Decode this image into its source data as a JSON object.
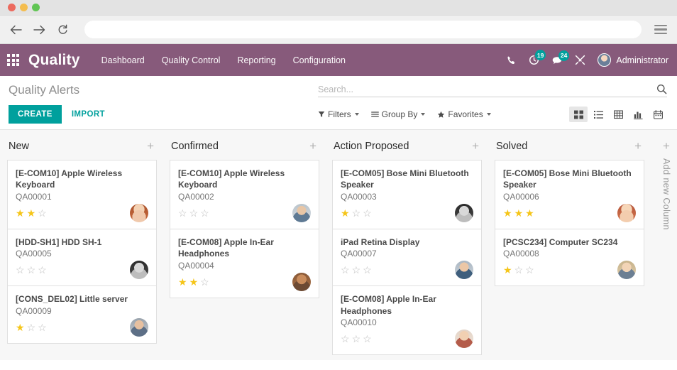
{
  "browser": {
    "back_icon": "back-arrow-icon",
    "forward_icon": "forward-arrow-icon",
    "reload_icon": "reload-icon",
    "url_value": "",
    "menu_icon": "hamburger-menu-icon"
  },
  "navbar": {
    "apps_icon": "apps-grid-icon",
    "brand": "Quality",
    "menu": [
      {
        "label": "Dashboard"
      },
      {
        "label": "Quality Control"
      },
      {
        "label": "Reporting"
      },
      {
        "label": "Configuration"
      }
    ],
    "phone_icon": "phone-icon",
    "activity_icon": "clock-activity-icon",
    "activity_count": "19",
    "messages_icon": "chat-bubble-icon",
    "messages_count": "24",
    "tools_icon": "wrench-tools-icon",
    "user_name": "Administrator",
    "accent_color": "#875a7b",
    "badge_color": "#00a09d"
  },
  "control_panel": {
    "title": "Quality Alerts",
    "create_label": "CREATE",
    "import_label": "IMPORT",
    "create_color": "#00a09d",
    "search": {
      "placeholder": "Search...",
      "value": "",
      "icon": "search-icon"
    },
    "filters": [
      {
        "label": "Filters",
        "icon": "filter-funnel-icon"
      },
      {
        "label": "Group By",
        "icon": "group-lines-icon"
      },
      {
        "label": "Favorites",
        "icon": "star-icon"
      }
    ],
    "views": [
      {
        "name": "kanban",
        "icon": "kanban-view-icon",
        "active": true
      },
      {
        "name": "list",
        "icon": "list-view-icon",
        "active": false
      },
      {
        "name": "pivot",
        "icon": "pivot-table-view-icon",
        "active": false
      },
      {
        "name": "graph",
        "icon": "bar-chart-view-icon",
        "active": false
      },
      {
        "name": "calendar",
        "icon": "calendar-view-icon",
        "active": false
      }
    ]
  },
  "kanban": {
    "add_column_label": "Add new Column",
    "columns": [
      {
        "title": "New",
        "cards": [
          {
            "title": "[E-COM10] Apple Wireless Keyboard",
            "ref": "QA00001",
            "stars": 2,
            "avatar": "woman-red-hair-avatar"
          },
          {
            "title": "[HDD-SH1] HDD SH-1",
            "ref": "QA00005",
            "stars": 0,
            "avatar": "woman-bw-avatar"
          },
          {
            "title": "[CONS_DEL02] Little server",
            "ref": "QA00009",
            "stars": 1,
            "avatar": "man-dark-hair-avatar"
          }
        ]
      },
      {
        "title": "Confirmed",
        "cards": [
          {
            "title": "[E-COM10] Apple Wireless Keyboard",
            "ref": "QA00002",
            "stars": 0,
            "avatar": "man-beard-avatar"
          },
          {
            "title": "[E-COM08] Apple In-Ear Headphones",
            "ref": "QA00004",
            "stars": 2,
            "avatar": "man-tan-avatar"
          }
        ]
      },
      {
        "title": "Action Proposed",
        "cards": [
          {
            "title": "[E-COM05] Bose Mini Bluetooth Speaker",
            "ref": "QA00003",
            "stars": 1,
            "avatar": "woman-bw-avatar"
          },
          {
            "title": "iPad Retina Display",
            "ref": "QA00007",
            "stars": 0,
            "avatar": "man-blue-shirt-avatar"
          },
          {
            "title": "[E-COM08] Apple In-Ear Headphones",
            "ref": "QA00010",
            "stars": 0,
            "avatar": "man-young-avatar"
          }
        ]
      },
      {
        "title": "Solved",
        "cards": [
          {
            "title": "[E-COM05] Bose Mini Bluetooth Speaker",
            "ref": "QA00006",
            "stars": 3,
            "avatar": "woman-smiling-avatar"
          },
          {
            "title": "[PCSC234] Computer SC234",
            "ref": "QA00008",
            "stars": 1,
            "avatar": "woman-blonde-avatar"
          }
        ]
      }
    ],
    "star_filled_color": "#f5c518",
    "star_empty_color": "#bdbdbd"
  }
}
